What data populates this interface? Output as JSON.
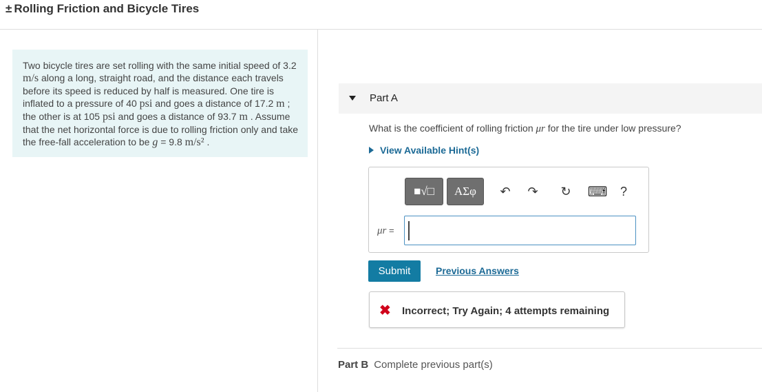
{
  "header": {
    "title": "Rolling Friction and Bicycle Tires",
    "pm": "±"
  },
  "problem": {
    "t1": "Two bicycle tires are set rolling with the same initial speed of 3.2 ",
    "u1": "m/s",
    "t2": " along a long, straight road, and the distance each travels before its speed is reduced by half is measured. One tire is inflated to a pressure of 40 ",
    "u2": "psi",
    "t3": " and goes a distance of 17.2 ",
    "u3": "m",
    "t4": " ; the other is at 105 ",
    "u4": "psi",
    "t5": " and goes a distance of 93.7 ",
    "u5": "m",
    "t6": " . Assume that the net horizontal force is due to rolling friction only and take the free-fall acceleration to be ",
    "g": "g",
    "t7": " = 9.8 ",
    "u7": "m/s²",
    "t8": " ."
  },
  "partA": {
    "label": "Part A",
    "question_pre": "What is the coefficient of rolling friction ",
    "question_sym": "μr",
    "question_post": " for the tire under low pressure?",
    "hint": "View Available Hint(s)"
  },
  "toolbar": {
    "template_btn": "■√□",
    "greek_btn": "ΑΣφ",
    "undo": "↶",
    "redo": "↷",
    "reset": "↻",
    "keyboard": "⌨",
    "help": "?"
  },
  "answer": {
    "label_sym": "μr",
    "label_eq": " =",
    "value": ""
  },
  "actions": {
    "submit": "Submit",
    "previous": "Previous Answers"
  },
  "feedback": {
    "mark": "✖",
    "message": "Incorrect; Try Again; 4 attempts remaining",
    "color": "#d0021b"
  },
  "partB": {
    "label": "Part B",
    "status": "Complete previous part(s)"
  }
}
